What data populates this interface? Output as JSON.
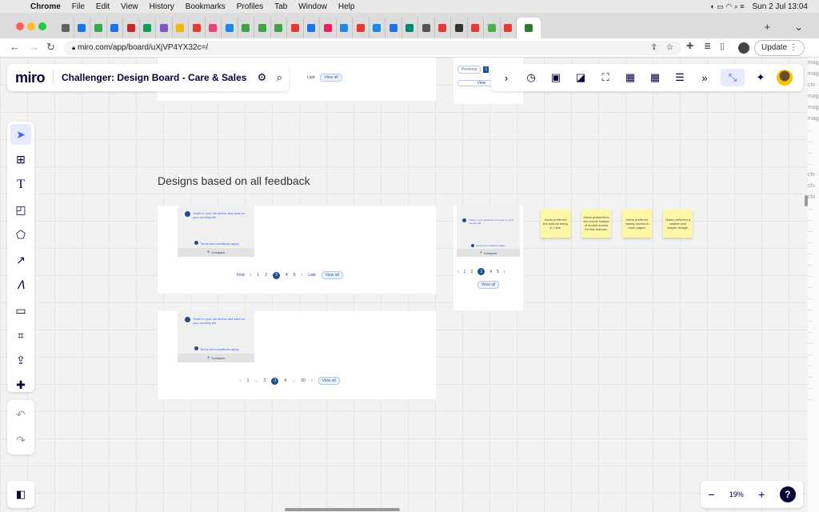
{
  "menubar": {
    "app": "Chrome",
    "items": [
      "File",
      "Edit",
      "View",
      "History",
      "Bookmarks",
      "Profiles",
      "Tab",
      "Window",
      "Help"
    ],
    "datetime": "Sun 2 Jul  13:04"
  },
  "browser": {
    "url": "miro.com/app/board/uXjVP4YX32c=/",
    "update_label": "Update",
    "tab_colors": [
      "#5f6368",
      "#1a73e8",
      "#34a853",
      "#1a73e8",
      "#c62828",
      "#0f9d58",
      "#7e57c2",
      "#f4b400",
      "#e53935",
      "#ec407a",
      "#1e88e5",
      "#43a047",
      "#43a047",
      "#43a047",
      "#e53935",
      "#1a73e8",
      "#e91e63",
      "#1e88e5",
      "#e53935",
      "#1e88e5",
      "#1a73e8",
      "#00897b",
      "#555555",
      "#e53935",
      "#333333",
      "#e53935",
      "#4caf50",
      "#e53935",
      "#2e7d32"
    ]
  },
  "miro": {
    "logo": "miro",
    "board_title": "Challenger: Design Board - Care & Sales",
    "section_title": "Designs based on all feedback",
    "zoom": "19%",
    "help": "?"
  },
  "frames": {
    "top_pager": {
      "last": "Last",
      "view_all": "View all"
    },
    "top_right_pager": {
      "previous": "Previous",
      "page": "1",
      "view": "View"
    },
    "card_text": "Trade in your old device and save on your monthly bill",
    "terms": "Terms and conditions apply",
    "compare": "Compare",
    "pager1": {
      "first": "First",
      "pages": [
        "1",
        "2",
        "3",
        "4",
        "5"
      ],
      "current": "3",
      "last": "Last",
      "view_all": "View all"
    },
    "pager2": {
      "pages": [
        "1",
        "...",
        "2",
        "3",
        "4",
        "...",
        "20"
      ],
      "current": "3",
      "view_all": "View all"
    },
    "pager3": {
      "pages": [
        "1",
        "2",
        "3",
        "4",
        "5"
      ],
      "current": "3",
      "view_all": "View all"
    }
  },
  "stickies": [
    "Users preferred the buttons being in 1 line.",
    "Users preferred to see words instead of double arrows for first and last.",
    "Users preferred having access to more pages.",
    "Users preferred a cleaner and simpler design."
  ],
  "side_strip": [
    "mag",
    "mag",
    "chi",
    "mag",
    "mag",
    "mag",
    "...",
    "...",
    "...",
    "...",
    "chi",
    "chi",
    "chi",
    "...",
    "...",
    "...",
    "...",
    "...",
    "...",
    "...",
    "...",
    "...",
    "...",
    "...",
    "...",
    "...",
    "...",
    "...",
    "...",
    "...",
    "..."
  ]
}
